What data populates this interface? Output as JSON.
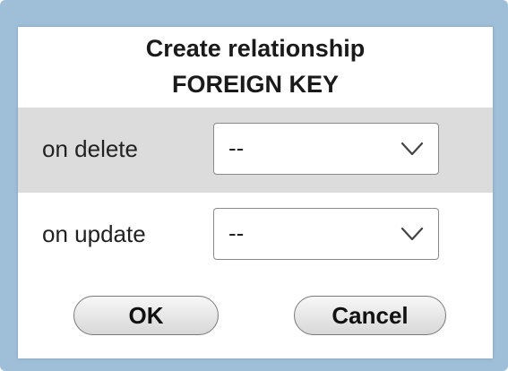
{
  "dialog": {
    "title_line1": "Create relationship",
    "title_line2": "FOREIGN KEY"
  },
  "on_delete": {
    "label": "on delete",
    "selected_value": "--",
    "icon": "chevron-down-icon"
  },
  "on_update": {
    "label": "on update",
    "selected_value": "--",
    "icon": "chevron-down-icon"
  },
  "buttons": {
    "ok_label": "OK",
    "cancel_label": "Cancel"
  },
  "colors": {
    "frame": "#9fbfd9",
    "dialog_background": "#ffffff",
    "highlighted_row": "#dcdcdc"
  }
}
